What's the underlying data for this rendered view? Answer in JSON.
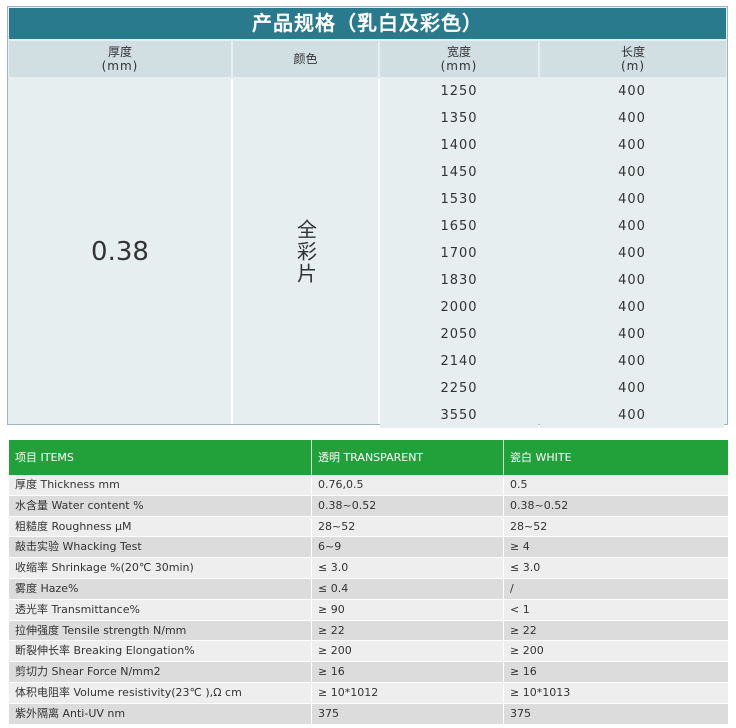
{
  "spec": {
    "title": "产品规格（乳白及彩色）",
    "headers": {
      "thickness": {
        "label": "厚度",
        "unit": "(mm)"
      },
      "color": {
        "label": "颜色"
      },
      "width": {
        "label": "宽度",
        "unit": "(mm)"
      },
      "length": {
        "label": "长度",
        "unit": "(m)"
      }
    },
    "thickness_value": "0.38",
    "color_value": "全彩片",
    "rows": [
      {
        "width": "1250",
        "length": "400"
      },
      {
        "width": "1350",
        "length": "400"
      },
      {
        "width": "1400",
        "length": "400"
      },
      {
        "width": "1450",
        "length": "400"
      },
      {
        "width": "1530",
        "length": "400"
      },
      {
        "width": "1650",
        "length": "400"
      },
      {
        "width": "1700",
        "length": "400"
      },
      {
        "width": "1830",
        "length": "400"
      },
      {
        "width": "2000",
        "length": "400"
      },
      {
        "width": "2050",
        "length": "400"
      },
      {
        "width": "2140",
        "length": "400"
      },
      {
        "width": "2250",
        "length": "400"
      },
      {
        "width": "3550",
        "length": "400"
      }
    ]
  },
  "props": {
    "headers": [
      "项目 ITEMS",
      "透明 TRANSPARENT",
      "瓷白 WHITE"
    ],
    "rows": [
      [
        "厚度 Thickness mm",
        "0.76,0.5",
        "0.5"
      ],
      [
        "水含量 Water content %",
        "0.38~0.52",
        "0.38~0.52"
      ],
      [
        "粗糙度 Roughness μM",
        "28~52",
        "28~52"
      ],
      [
        "敲击实验 Whacking Test",
        "6~9",
        "≥ 4"
      ],
      [
        "收缩率 Shrinkage %(20℃ 30min)",
        "≤ 3.0",
        "≤ 3.0"
      ],
      [
        "雾度 Haze%",
        "≤ 0.4",
        "/"
      ],
      [
        "透光率 Transmittance%",
        "≥ 90",
        "< 1"
      ],
      [
        "拉伸强度 Tensile strength N/mm",
        "≥ 22",
        "≥ 22"
      ],
      [
        "断裂伸长率 Breaking Elongation%",
        "≥ 200",
        "≥ 200"
      ],
      [
        "剪切力 Shear Force  N/mm2",
        "≥ 16",
        "≥ 16"
      ],
      [
        "体积电阻率 Volume resistivity(23℃ ),Ω cm",
        "≥ 10*1012",
        "≥ 10*1013"
      ],
      [
        "紫外隔离 Anti-UV nm",
        "375",
        "375"
      ]
    ]
  }
}
